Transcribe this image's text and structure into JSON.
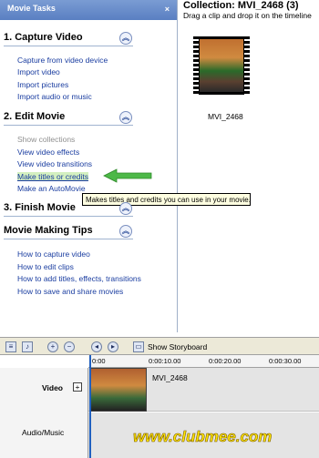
{
  "tasks_pane": {
    "title": "Movie Tasks",
    "close_glyph": "×",
    "sections": [
      {
        "title": "1. Capture Video",
        "links": [
          "Capture from video device",
          "Import video",
          "Import pictures",
          "Import audio or music"
        ]
      },
      {
        "title": "2. Edit Movie",
        "links": [
          "Show collections",
          "View video effects",
          "View video transitions",
          "Make titles or credits",
          "Make an AutoMovie"
        ]
      },
      {
        "title": "3. Finish Movie",
        "links": []
      },
      {
        "title": "Movie Making Tips",
        "links": [
          "How to capture video",
          "How to edit clips",
          "How to add titles, effects, transitions",
          "How to save and share movies"
        ]
      }
    ],
    "highlighted_link": "Make titles or credits",
    "tooltip": "Makes titles and credits you can use in your movie."
  },
  "collection": {
    "title": "Collection: MVI_2468 (3)",
    "subtitle": "Drag a clip and drop it on the timeline",
    "clip_name": "MVI_2468"
  },
  "timeline": {
    "show_storyboard_label": "Show Storyboard",
    "ruler_ticks": [
      "0:00",
      "0:00:10.00",
      "0:00:20.00",
      "0:00:30.00"
    ],
    "tracks": {
      "video_label": "Video",
      "video_expand": "+",
      "audio_label": "Audio/Music"
    },
    "clip_name": "MVI_2468"
  },
  "watermark": "www.clubmee.com",
  "colors": {
    "highlight": "#d4f0c0",
    "link": "#1a3da0",
    "arrow": "#4db848"
  }
}
